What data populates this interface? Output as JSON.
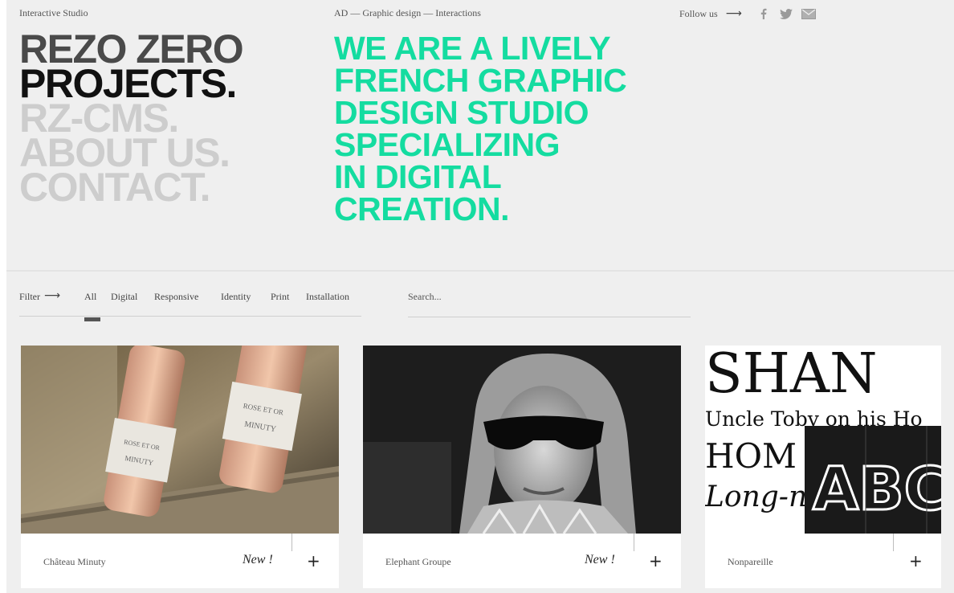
{
  "header": {
    "studio": "Interactive Studio",
    "tagline": "AD — Graphic design — Interactions",
    "follow_label": "Follow us",
    "follow_arrow": "⟶",
    "social": [
      "facebook-icon",
      "twitter-icon",
      "mail-icon"
    ]
  },
  "nav": {
    "line1": "REZO ZERO",
    "line2": "PROJECTS.",
    "line3": "RZ-CMS.",
    "line4": "ABOUT US.",
    "line5": "CONTACT."
  },
  "headline": {
    "lines": [
      "WE ARE A LIVELY",
      "FRENCH GRAPHIC",
      "DESIGN STUDIO",
      "SPECIALIZING",
      "IN DIGITAL",
      "CREATION."
    ],
    "color": "#14dca0"
  },
  "filter": {
    "label": "Filter",
    "arrow": "⟶",
    "items": [
      "All",
      "Digital",
      "Responsive",
      "Identity",
      "Print",
      "Installation"
    ],
    "active": "All"
  },
  "search": {
    "placeholder": "Search..."
  },
  "cards": [
    {
      "title": "Château Minuty",
      "badge": "New !",
      "plus": "+",
      "bottle_label_1": "ROSE ET OR",
      "bottle_label_2": "MINUTY"
    },
    {
      "title": "Elephant Groupe",
      "badge": "New !",
      "plus": "+"
    },
    {
      "title": "Nonpareille",
      "badge": "",
      "plus": "+",
      "type_line1": "SHAN",
      "type_line2": "Uncle Toby on his Ho",
      "type_line3": "HOM",
      "type_line4": "Long-n",
      "type_abc": "ABC"
    }
  ]
}
